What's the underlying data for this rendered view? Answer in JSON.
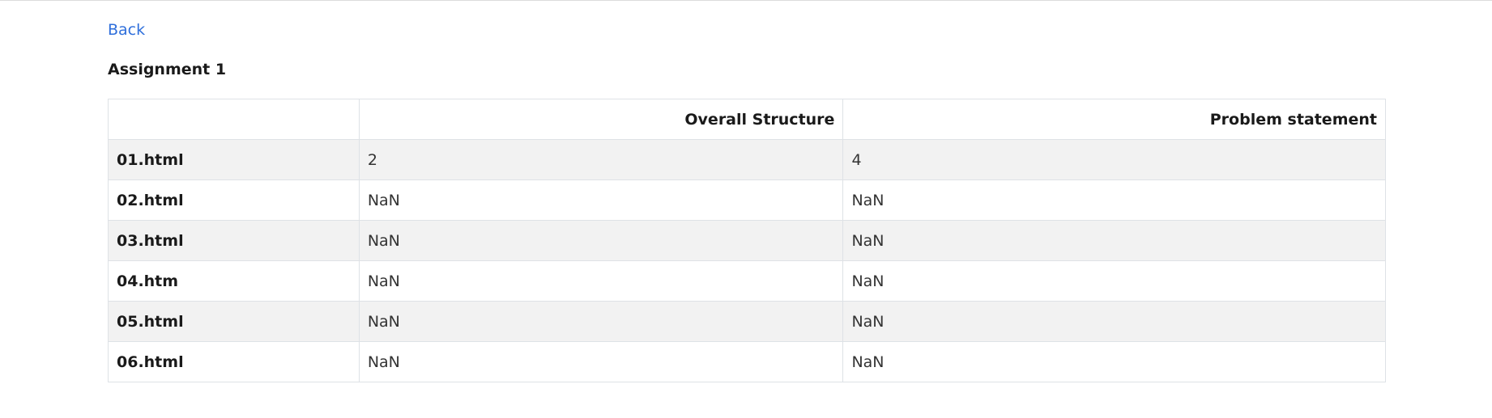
{
  "nav": {
    "back_label": "Back"
  },
  "assignment": {
    "title": "Assignment 1"
  },
  "table": {
    "corner": "",
    "columns": [
      "Overall Structure",
      "Problem statement"
    ],
    "rows": [
      {
        "file": "01.html",
        "values": [
          "2",
          "4"
        ]
      },
      {
        "file": "02.html",
        "values": [
          "NaN",
          "NaN"
        ]
      },
      {
        "file": "03.html",
        "values": [
          "NaN",
          "NaN"
        ]
      },
      {
        "file": "04.htm",
        "values": [
          "NaN",
          "NaN"
        ]
      },
      {
        "file": "05.html",
        "values": [
          "NaN",
          "NaN"
        ]
      },
      {
        "file": "06.html",
        "values": [
          "NaN",
          "NaN"
        ]
      }
    ]
  },
  "colors": {
    "link": "#2f6fdb",
    "stripe": "#f2f2f2",
    "border": "#dee2e6"
  }
}
